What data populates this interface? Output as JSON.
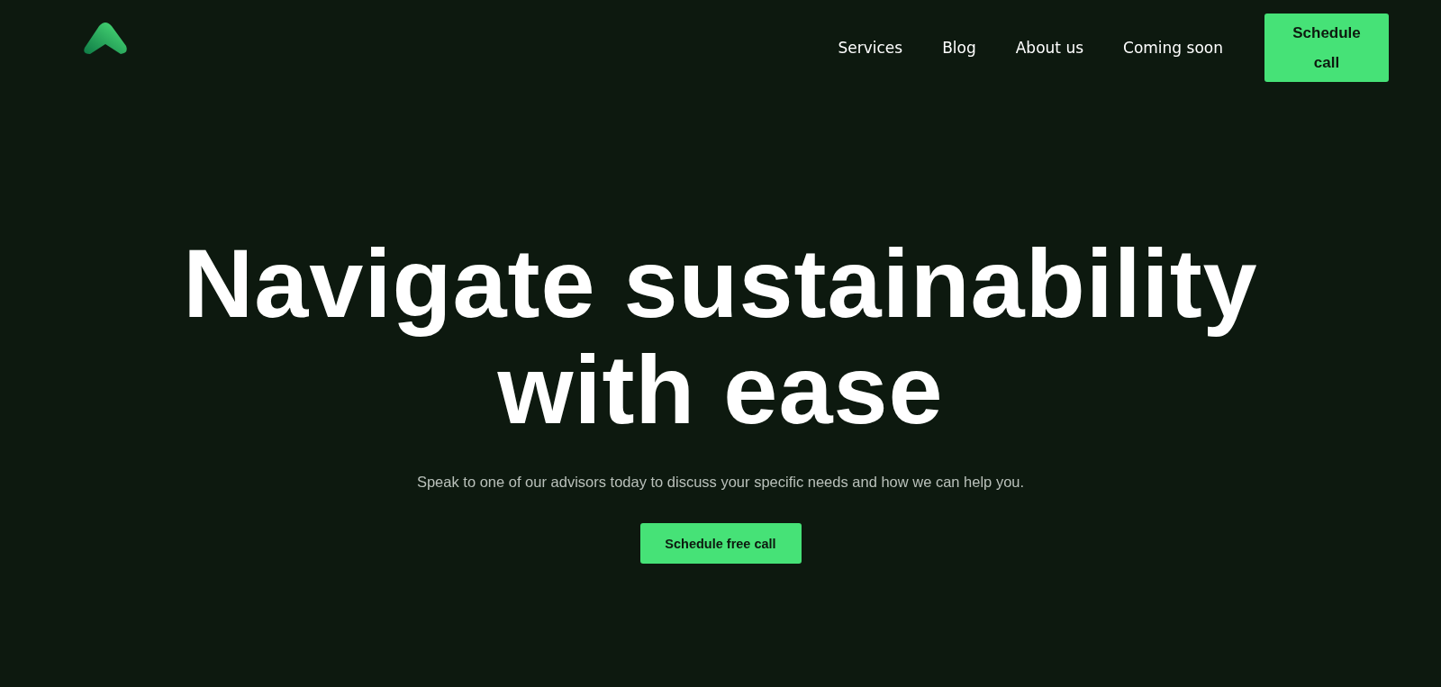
{
  "nav": {
    "links": [
      "Services",
      "Blog",
      "About us",
      "Coming soon"
    ],
    "cta": "Schedule call"
  },
  "hero": {
    "title_lines": [
      "Navigate sustainability",
      "with ease"
    ],
    "subtitle": "Speak to one of our advisors today to discuss your specific needs and how we can help you.",
    "button": "Schedule free call"
  }
}
